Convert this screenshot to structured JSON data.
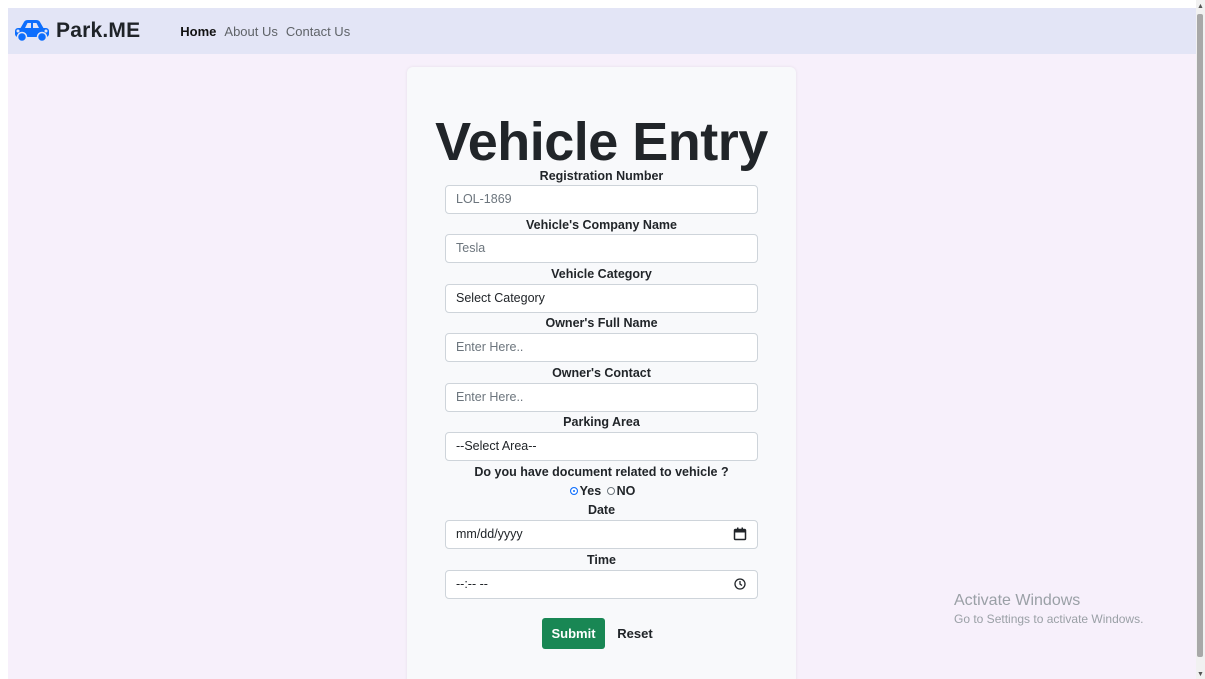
{
  "navbar": {
    "brand": "Park.ME",
    "links": [
      "Home",
      "About Us",
      "Contact Us"
    ]
  },
  "form": {
    "title": "Vehicle Entry",
    "registration": {
      "label": "Registration Number",
      "placeholder": "LOL-1869"
    },
    "company": {
      "label": "Vehicle's Company Name",
      "placeholder": "Tesla"
    },
    "category": {
      "label": "Vehicle Category",
      "value": "Select Category"
    },
    "owner_name": {
      "label": "Owner's Full Name",
      "placeholder": "Enter Here.."
    },
    "owner_contact": {
      "label": "Owner's Contact",
      "placeholder": "Enter Here.."
    },
    "parking_area": {
      "label": "Parking Area",
      "value": "--Select Area--"
    },
    "document": {
      "question": "Do you have document related to vehicle ?",
      "yes": "Yes",
      "no": "NO",
      "selected": "Yes"
    },
    "date": {
      "label": "Date",
      "value": "mm/dd/yyyy"
    },
    "time": {
      "label": "Time",
      "value": "--:-- --"
    },
    "submit": "Submit",
    "reset": "Reset"
  },
  "watermark": {
    "line1": "Activate Windows",
    "line2": "Go to Settings to activate Windows."
  },
  "colors": {
    "nav_bg": "#e3e5f6",
    "page_bg": "#f7f0fb",
    "submit": "#198754",
    "brand_icon": "#0d6efd"
  }
}
